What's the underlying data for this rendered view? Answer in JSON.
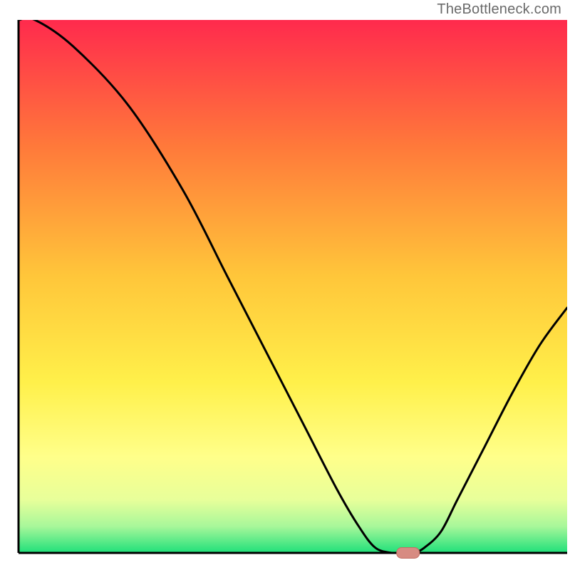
{
  "watermark": "TheBottleneck.com",
  "colors": {
    "gradient_top": "#ff2a4d",
    "gradient_upper_mid": "#ff8a2a",
    "gradient_mid": "#ffd42a",
    "gradient_lower_mid": "#ffff66",
    "gradient_light_yellow": "#ffff9e",
    "gradient_light_green": "#b6f7a0",
    "gradient_green": "#1fe07a",
    "axis": "#000000",
    "line": "#000000",
    "marker_fill": "#d78b82",
    "marker_stroke": "#c26f65",
    "background": "#ffffff"
  },
  "chart_data": {
    "type": "line",
    "title": "",
    "xlabel": "",
    "ylabel": "",
    "xlim": [
      0,
      100
    ],
    "ylim": [
      0,
      100
    ],
    "x": [
      0,
      3,
      10,
      20,
      30,
      38,
      45,
      52,
      58,
      62,
      65,
      68,
      70,
      72,
      74,
      77,
      80,
      85,
      90,
      95,
      100
    ],
    "values": [
      100,
      100,
      95,
      84,
      68,
      52,
      38,
      24,
      12,
      5,
      1,
      0,
      0,
      0,
      1,
      4,
      10,
      20,
      30,
      39,
      46
    ],
    "marker": {
      "x": 71,
      "y": 0
    },
    "annotations": []
  }
}
